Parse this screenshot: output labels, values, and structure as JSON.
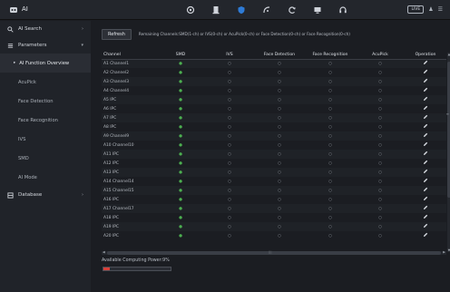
{
  "header": {
    "title": "AI",
    "live_label": "LIVE",
    "icons": [
      "settings-icon",
      "storage-icon",
      "shield-icon",
      "network-icon",
      "sync-icon",
      "display-icon",
      "headset-icon"
    ]
  },
  "sidebar": {
    "ai_search": "AI Search",
    "parameters": "Parameters",
    "items": [
      {
        "label": "AI Function Overview",
        "active": true
      },
      {
        "label": "AcuPick"
      },
      {
        "label": "Face Detection"
      },
      {
        "label": "Face Recognition"
      },
      {
        "label": "IVS"
      },
      {
        "label": "SMD"
      },
      {
        "label": "AI Mode"
      }
    ],
    "database": "Database"
  },
  "toolbar": {
    "refresh_label": "Refresh",
    "remaining_text": "Remaining Channels:SMD(1-ch) or IVS(0-ch) or AcuPick(0-ch) or Face Detection(0-ch) or Face Recognition(0-ch)"
  },
  "table": {
    "columns": [
      "Channel",
      "SMD",
      "IVS",
      "Face Detection",
      "Face Recognition",
      "AcuPick",
      "Operation"
    ],
    "rows": [
      {
        "channel": "A1 Channel1",
        "smd": "●",
        "ivs": "○",
        "fd": "○",
        "fr": "○",
        "acupick": "○"
      },
      {
        "channel": "A2 Channel2",
        "smd": "●",
        "ivs": "○",
        "fd": "○",
        "fr": "○",
        "acupick": "○"
      },
      {
        "channel": "A3 Channel3",
        "smd": "●",
        "ivs": "○",
        "fd": "○",
        "fr": "○",
        "acupick": "○"
      },
      {
        "channel": "A4 Channel4",
        "smd": "●",
        "ivs": "○",
        "fd": "○",
        "fr": "○",
        "acupick": "○"
      },
      {
        "channel": "A5 IPC",
        "smd": "●",
        "ivs": "○",
        "fd": "○",
        "fr": "○",
        "acupick": "○"
      },
      {
        "channel": "A6 IPC",
        "smd": "●",
        "ivs": "○",
        "fd": "○",
        "fr": "○",
        "acupick": "○"
      },
      {
        "channel": "A7 IPC",
        "smd": "●",
        "ivs": "○",
        "fd": "○",
        "fr": "○",
        "acupick": "○"
      },
      {
        "channel": "A8 IPC",
        "smd": "●",
        "ivs": "○",
        "fd": "○",
        "fr": "○",
        "acupick": "○"
      },
      {
        "channel": "A9 Channel9",
        "smd": "●",
        "ivs": "○",
        "fd": "○",
        "fr": "○",
        "acupick": "○"
      },
      {
        "channel": "A10 Channel10",
        "smd": "●",
        "ivs": "○",
        "fd": "○",
        "fr": "○",
        "acupick": "○"
      },
      {
        "channel": "A11 IPC",
        "smd": "●",
        "ivs": "○",
        "fd": "○",
        "fr": "○",
        "acupick": "○"
      },
      {
        "channel": "A12 IPC",
        "smd": "●",
        "ivs": "○",
        "fd": "○",
        "fr": "○",
        "acupick": "○"
      },
      {
        "channel": "A13 IPC",
        "smd": "●",
        "ivs": "○",
        "fd": "○",
        "fr": "○",
        "acupick": "○"
      },
      {
        "channel": "A14 Channel14",
        "smd": "●",
        "ivs": "○",
        "fd": "○",
        "fr": "○",
        "acupick": "○"
      },
      {
        "channel": "A15 Channel15",
        "smd": "●",
        "ivs": "○",
        "fd": "○",
        "fr": "○",
        "acupick": "○"
      },
      {
        "channel": "A16 IPC",
        "smd": "●",
        "ivs": "○",
        "fd": "○",
        "fr": "○",
        "acupick": "○"
      },
      {
        "channel": "A17 Channel17",
        "smd": "●",
        "ivs": "○",
        "fd": "○",
        "fr": "○",
        "acupick": "○"
      },
      {
        "channel": "A18 IPC",
        "smd": "●",
        "ivs": "○",
        "fd": "○",
        "fr": "○",
        "acupick": "○"
      },
      {
        "channel": "A19 IPC",
        "smd": "●",
        "ivs": "○",
        "fd": "○",
        "fr": "○",
        "acupick": "○"
      },
      {
        "channel": "A20 IPC",
        "smd": "●",
        "ivs": "○",
        "fd": "○",
        "fr": "○",
        "acupick": "○"
      }
    ]
  },
  "computing_power": {
    "label": "Available Computing Power:9%",
    "percent": 9
  },
  "colors": {
    "accent": "#2e7bd6",
    "smd_enabled": "#4caf50",
    "power_fill": "#d8403a"
  }
}
